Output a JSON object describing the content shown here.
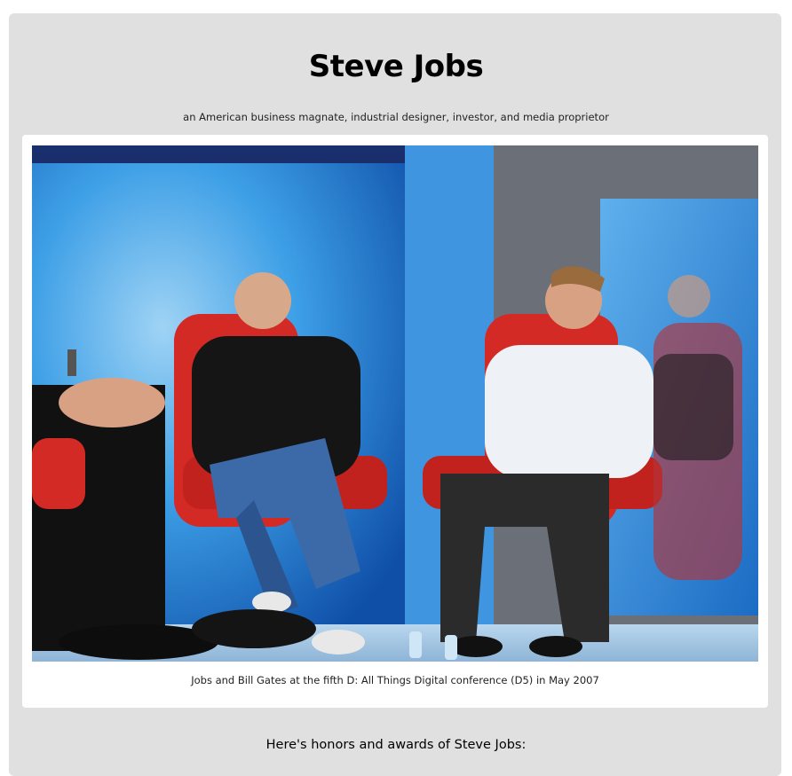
{
  "page": {
    "title": "Steve Jobs",
    "subtitle": "an American business magnate, industrial designer, investor, and media proprietor",
    "figure": {
      "image_alt": "Jobs and Bill Gates seated in red chairs on stage",
      "caption": "Jobs and Bill Gates at the fifth D: All Things Digital conference (D5) in May 2007"
    },
    "honors_heading": "Here's honors and awards of Steve Jobs:"
  },
  "colors": {
    "page_background": "#e0e0e0",
    "card_background": "#ffffff",
    "chair_red": "#d42a25",
    "stage_blue": "#1f7fd6"
  }
}
